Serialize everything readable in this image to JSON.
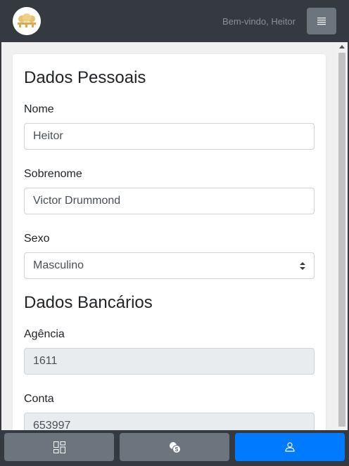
{
  "header": {
    "logo_icon": "brand-logo",
    "welcome_text": "Bem-vindo, Heitor",
    "menu_icon": "hamburger-icon"
  },
  "personal": {
    "title": "Dados Pessoais",
    "first_name_label": "Nome",
    "first_name_value": "Heitor",
    "last_name_label": "Sobrenome",
    "last_name_value": "Victor Drummond",
    "gender_label": "Sexo",
    "gender_selected": "Masculino"
  },
  "bank": {
    "title": "Dados Bancários",
    "agency_label": "Agência",
    "agency_value": "1611",
    "account_label": "Conta",
    "account_value": "653997"
  },
  "bottom_nav": [
    {
      "icon": "dashboard-grid-icon",
      "active": false
    },
    {
      "icon": "coins-icon",
      "active": false
    },
    {
      "icon": "user-icon",
      "active": true
    }
  ],
  "colors": {
    "navbar": "#343a40",
    "secondary_button": "#6c757d",
    "primary_button": "#007bff",
    "readonly_field": "#e9ecef"
  }
}
